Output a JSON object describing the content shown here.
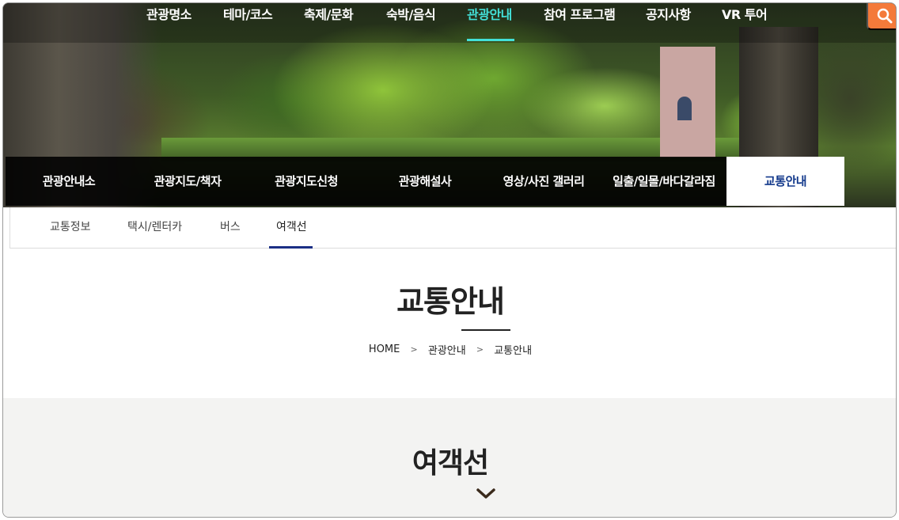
{
  "gnb": {
    "items": [
      "관광명소",
      "테마/코스",
      "축제/문화",
      "숙박/음식",
      "관광안내",
      "참여 프로그램",
      "공지사항",
      "VR 투어"
    ],
    "active_index": 4,
    "active_color": "#43e0d8",
    "search_icon": "search-icon",
    "search_color": "#f47a3a"
  },
  "lnb": {
    "items": [
      "관광안내소",
      "관광지도/책자",
      "관광지도신청",
      "관광해설사",
      "영상/사진 갤러리",
      "일출/일몰/바다갈라짐",
      "교통안내"
    ],
    "active_index": 6,
    "active_text_color": "#143a8c"
  },
  "tabs": {
    "items": [
      "교통정보",
      "택시/렌터카",
      "버스",
      "여객선"
    ],
    "active_index": 3,
    "underline_color": "#1b2f85"
  },
  "page": {
    "title": "교통안내",
    "breadcrumb": [
      "HOME",
      "관광안내",
      "교통안내"
    ],
    "breadcrumb_separator": ">"
  },
  "section": {
    "title": "여객선",
    "toggle_icon": "chevron-down-icon"
  }
}
